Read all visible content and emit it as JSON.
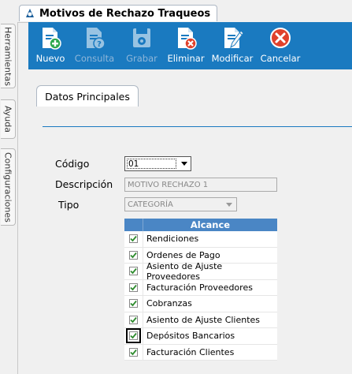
{
  "window": {
    "title": "Motivos de Rechazo Traqueos"
  },
  "side_tabs": [
    {
      "label": "Herramientas"
    },
    {
      "label": "Ayuda"
    },
    {
      "label": "Configuraciones"
    }
  ],
  "toolbar": {
    "nuevo": {
      "label": "Nuevo",
      "icon": "add-document-icon",
      "enabled": true
    },
    "consulta": {
      "label": "Consulta",
      "icon": "query-document-icon",
      "enabled": false
    },
    "grabar": {
      "label": "Grabar",
      "icon": "save-icon",
      "enabled": false
    },
    "eliminar": {
      "label": "Eliminar",
      "icon": "delete-document-icon",
      "enabled": true
    },
    "modificar": {
      "label": "Modificar",
      "icon": "edit-document-icon",
      "enabled": true
    },
    "cancelar": {
      "label": "Cancelar",
      "icon": "cancel-icon",
      "enabled": true
    }
  },
  "form": {
    "tab_label": "Datos Principales",
    "codigo": {
      "label": "Código",
      "value": "01"
    },
    "descripcion": {
      "label": "Descripción",
      "value": "MOTIVO RECHAZO 1"
    },
    "tipo": {
      "label": "Tipo",
      "value": "CATEGORÍA"
    }
  },
  "alcance": {
    "header": "Alcance",
    "rows": [
      {
        "label": "Rendiciones",
        "checked": true
      },
      {
        "label": "Ordenes de Pago",
        "checked": true
      },
      {
        "label": "Asiento de Ajuste Proveedores",
        "checked": true
      },
      {
        "label": "Facturación Proveedores",
        "checked": true
      },
      {
        "label": "Cobranzas",
        "checked": true
      },
      {
        "label": "Asiento de Ajuste Clientes",
        "checked": true
      },
      {
        "label": "Depósitos Bancarios",
        "checked": true
      },
      {
        "label": "Facturación Clientes",
        "checked": true
      }
    ]
  },
  "colors": {
    "toolbar_bg": "#1a7ac0",
    "grid_header_bg": "#4a86c5",
    "check_color": "#2e8b2e"
  }
}
